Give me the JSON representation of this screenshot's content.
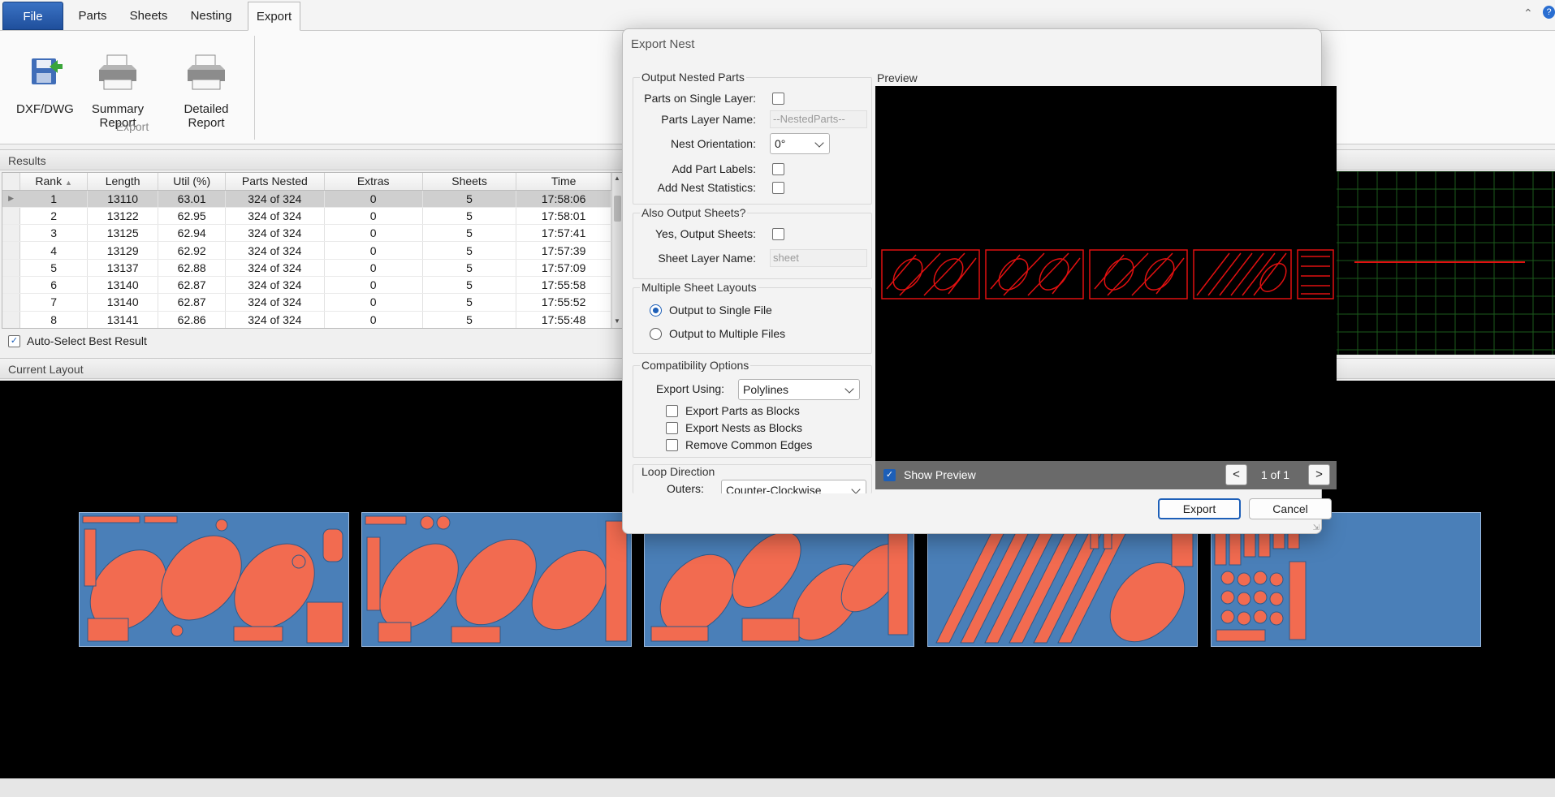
{
  "ribbon": {
    "tabs": [
      "File",
      "Parts",
      "Sheets",
      "Nesting",
      "Export"
    ],
    "active_tab": "Export",
    "buttons": [
      "DXF/DWG",
      "Summary Report",
      "Detailed Report"
    ],
    "group_label": "Export"
  },
  "results": {
    "header": "Results",
    "columns": [
      "Rank",
      "Length",
      "Util (%)",
      "Parts Nested",
      "Extras",
      "Sheets",
      "Time"
    ],
    "rows": [
      [
        "1",
        "13110",
        "63.01",
        "324 of 324",
        "0",
        "5",
        "17:58:06"
      ],
      [
        "2",
        "13122",
        "62.95",
        "324 of 324",
        "0",
        "5",
        "17:58:01"
      ],
      [
        "3",
        "13125",
        "62.94",
        "324 of 324",
        "0",
        "5",
        "17:57:41"
      ],
      [
        "4",
        "13129",
        "62.92",
        "324 of 324",
        "0",
        "5",
        "17:57:39"
      ],
      [
        "5",
        "13137",
        "62.88",
        "324 of 324",
        "0",
        "5",
        "17:57:09"
      ],
      [
        "6",
        "13140",
        "62.87",
        "324 of 324",
        "0",
        "5",
        "17:55:58"
      ],
      [
        "7",
        "13140",
        "62.87",
        "324 of 324",
        "0",
        "5",
        "17:55:52"
      ],
      [
        "8",
        "13141",
        "62.86",
        "324 of 324",
        "0",
        "5",
        "17:55:48"
      ]
    ],
    "selected_row": 0,
    "auto_select_label": "Auto-Select Best Result",
    "auto_select_checked": true
  },
  "layout": {
    "header": "Current Layout",
    "sheet_count": 5,
    "last_sheet_fill": 0.36
  },
  "dialog": {
    "title": "Export Nest",
    "output_nested_parts": {
      "legend": "Output Nested Parts",
      "single_layer_label": "Parts on Single Layer:",
      "single_layer_checked": false,
      "layer_name_label": "Parts Layer Name:",
      "layer_name_value": "--NestedParts--",
      "orientation_label": "Nest Orientation:",
      "orientation_value": "0°",
      "part_labels_label": "Add Part Labels:",
      "part_labels_checked": false,
      "nest_stats_label": "Add Nest Statistics:",
      "nest_stats_checked": false
    },
    "output_sheets": {
      "legend": "Also Output Sheets?",
      "yes_label": "Yes, Output Sheets:",
      "yes_checked": false,
      "sheet_layer_label": "Sheet Layer Name:",
      "sheet_layer_value": "sheet"
    },
    "multiple_layouts": {
      "legend": "Multiple Sheet Layouts",
      "options": [
        "Output to Single File",
        "Output to Multiple Files"
      ],
      "selected": 0
    },
    "compatibility": {
      "legend": "Compatibility Options",
      "export_using_label": "Export Using:",
      "export_using_value": "Polylines",
      "checks": [
        "Export Parts as Blocks",
        "Export Nests as Blocks",
        "Remove Common Edges"
      ]
    },
    "loop_direction": {
      "legend": "Loop Direction",
      "outers_label": "Outers:",
      "outers_value": "Counter-Clockwise"
    },
    "preview": {
      "legend": "Preview",
      "show_preview_label": "Show Preview",
      "show_preview_checked": true,
      "prev": "<",
      "page": "1 of 1",
      "next": ">"
    },
    "export_label": "Export",
    "cancel_label": "Cancel"
  },
  "colors": {
    "part_fill": "#f26b50",
    "sheet_fill": "#4a7fb8",
    "preview_stroke": "#e01010",
    "accent": "#1d5fb8"
  }
}
